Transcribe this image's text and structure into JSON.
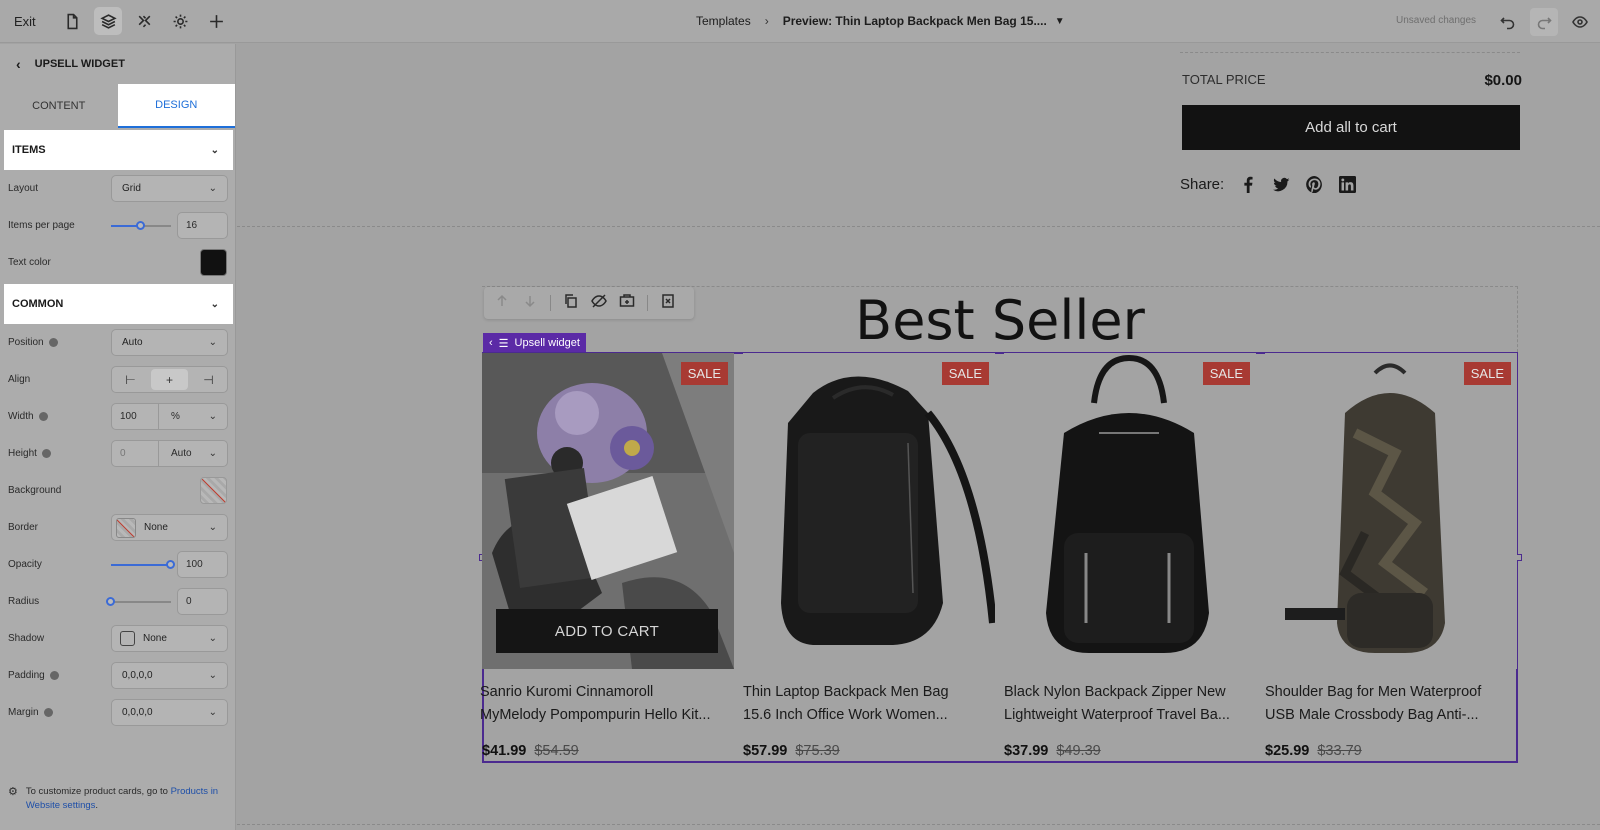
{
  "topbar": {
    "exit_label": "Exit",
    "breadcrumb_root": "Templates",
    "breadcrumb_current": "Preview: Thin Laptop Backpack Men Bag 15....",
    "unsaved": "Unsaved changes",
    "icons": [
      "page-icon",
      "layers-icon",
      "puzzle-icon",
      "gear-icon",
      "plus-icon",
      "undo-icon",
      "redo-icon",
      "eye-icon"
    ]
  },
  "sidebar": {
    "title": "UPSELL WIDGET",
    "tabs": [
      "CONTENT",
      "DESIGN"
    ],
    "active_tab": "DESIGN",
    "items_section": "ITEMS",
    "layout_label": "Layout",
    "layout_value": "Grid",
    "items_per_page_label": "Items per page",
    "items_per_page_value": "16",
    "items_per_page_level": 0.5,
    "text_color_label": "Text color",
    "text_color_value": "#111111",
    "common_section": "COMMON",
    "position_label": "Position",
    "position_value": "Auto",
    "align_label": "Align",
    "align_selected": "center",
    "width_label": "Width",
    "width_value": "100",
    "width_unit": "%",
    "height_label": "Height",
    "height_value": "0",
    "height_unit": "Auto",
    "background_label": "Background",
    "border_label": "Border",
    "border_value": "None",
    "opacity_label": "Opacity",
    "opacity_value": "100",
    "opacity_level": 1.0,
    "radius_label": "Radius",
    "radius_value": "0",
    "radius_level": 0.0,
    "shadow_label": "Shadow",
    "shadow_value": "None",
    "padding_label": "Padding",
    "padding_value": "0,0,0,0",
    "margin_label": "Margin",
    "margin_value": "0,0,0,0",
    "footer_text": "To customize product cards, go to",
    "footer_link": "Products in Website settings",
    "footer_end": "."
  },
  "canvas": {
    "total_label": "TOTAL PRICE",
    "total_value": "$0.00",
    "add_all_label": "Add all to cart",
    "share_label": "Share:",
    "share_icons": [
      "facebook-icon",
      "twitter-icon",
      "pinterest-icon",
      "linkedin-icon"
    ],
    "section_title": "Best Seller",
    "widget_label": "Upsell widget",
    "add_to_cart_label": "ADD TO CART",
    "sale_badge": "SALE",
    "products": [
      {
        "line1": "Sanrio Kuromi Cinnamoroll",
        "line2": "MyMelody Pompompurin Hello Kit...",
        "price": "$41.99",
        "compare": "$54.59"
      },
      {
        "line1": "Thin Laptop Backpack Men Bag",
        "line2": "15.6 Inch Office Work Women...",
        "price": "$57.99",
        "compare": "$75.39"
      },
      {
        "line1": "Black Nylon Backpack Zipper New",
        "line2": "Lightweight Waterproof Travel Ba...",
        "price": "$37.99",
        "compare": "$49.39"
      },
      {
        "line1": "Shoulder Bag for Men Waterproof",
        "line2": "USB Male Crossbody Bag Anti-...",
        "price": "$25.99",
        "compare": "$33.79"
      }
    ]
  },
  "colors": {
    "accent": "#1e6fd9",
    "selection": "#4b2a8f",
    "sale": "#a83a33",
    "button": "#121212"
  }
}
